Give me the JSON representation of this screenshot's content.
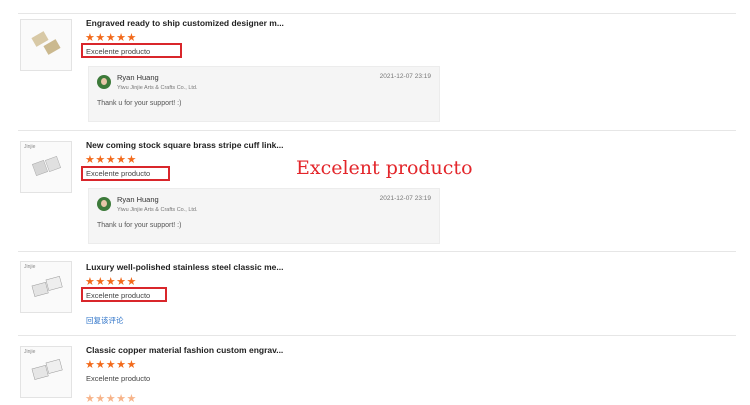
{
  "overlay_text": "Excelent producto",
  "reviews": [
    {
      "title": "Engraved ready to ship customized designer m...",
      "stars": "★★★★★",
      "comment": "Excelente producto",
      "reply": {
        "name": "Ryan Huang",
        "company": "Yiwu Jinjie Arts & Crafts Co., Ltd.",
        "date": "2021-12-07 23:19",
        "text": "Thank u for your support! :)"
      }
    },
    {
      "title": "New coming stock square brass stripe cuff link...",
      "stars": "★★★★★",
      "comment": "Excelente producto",
      "thumb_brand": "Jinjie",
      "reply": {
        "name": "Ryan Huang",
        "company": "Yiwu Jinjie Arts & Crafts Co., Ltd.",
        "date": "2021-12-07 23:19",
        "text": "Thank u for your support! :)"
      }
    },
    {
      "title": "Luxury well-polished stainless steel classic me...",
      "stars": "★★★★★",
      "comment": "Excelente producto",
      "thumb_brand": "Jinjie",
      "link": "回复该评论"
    },
    {
      "title": "Classic copper material fashion custom engrav...",
      "stars": "★★★★★",
      "comment": "Excelente producto",
      "thumb_brand": "Jinjie"
    }
  ]
}
